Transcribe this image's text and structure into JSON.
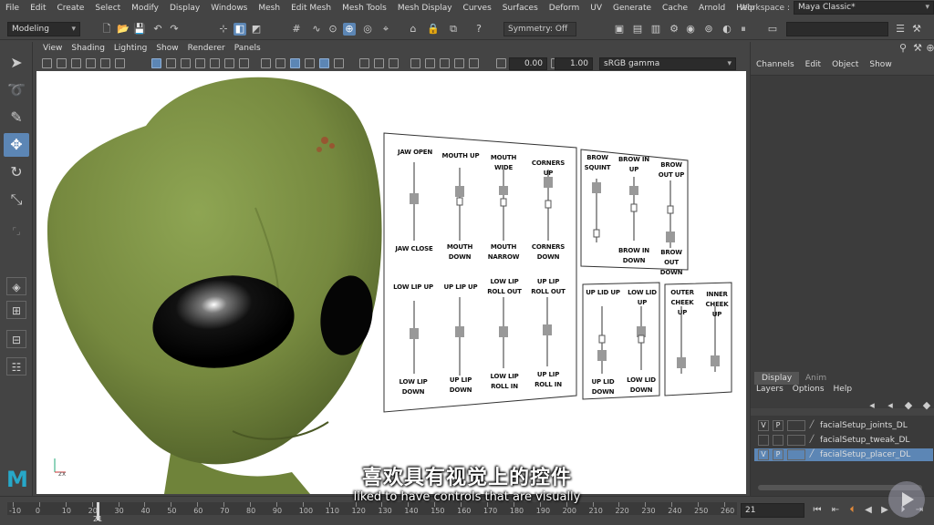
{
  "menubar": {
    "items": [
      "File",
      "Edit",
      "Create",
      "Select",
      "Modify",
      "Display",
      "Windows",
      "Mesh",
      "Edit Mesh",
      "Mesh Tools",
      "Mesh Display",
      "Curves",
      "Surfaces",
      "Deform",
      "UV",
      "Generate",
      "Cache",
      "Arnold",
      "Help"
    ],
    "workspace_label": "Workspace :",
    "workspace_value": "Maya Classic*"
  },
  "statusline": {
    "mode": "Modeling",
    "symmetry": "Symmetry: Off"
  },
  "panel": {
    "menu": [
      "View",
      "Shading",
      "Lighting",
      "Show",
      "Renderer",
      "Panels"
    ],
    "exposure": "0.00",
    "gamma": "1.00",
    "color_space": "sRGB gamma"
  },
  "controls": {
    "panel1": {
      "row1": [
        {
          "top": "JAW OPEN",
          "bottom": "JAW CLOSE"
        },
        {
          "top": "MOUTH UP",
          "bottom": "MOUTH DOWN"
        },
        {
          "top": "MOUTH WIDE",
          "bottom": "MOUTH NARROW"
        },
        {
          "top": "CORNERS UP",
          "bottom": "CORNERS DOWN"
        }
      ],
      "row2": [
        {
          "top": "LOW LIP UP",
          "bottom": "LOW LIP DOWN"
        },
        {
          "top": "UP LIP UP",
          "bottom": "UP LIP DOWN"
        },
        {
          "top": "LOW LIP ROLL OUT",
          "bottom": "LOW LIP ROLL IN"
        },
        {
          "top": "UP LIP ROLL OUT",
          "bottom": "UP LIP ROLL IN"
        }
      ]
    },
    "panel2": [
      {
        "top": "BROW SQUINT",
        "bottom": ""
      },
      {
        "top": "BROW IN UP",
        "bottom": "BROW IN DOWN"
      },
      {
        "top": "BROW OUT UP",
        "bottom": "BROW OUT DOWN"
      }
    ],
    "panel3": [
      {
        "top": "UP LID UP",
        "bottom": "UP LID DOWN"
      },
      {
        "top": "LOW LID UP",
        "bottom": "LOW LID DOWN"
      }
    ],
    "panel4": [
      {
        "top": "OUTER CHEEK UP",
        "bottom": ""
      },
      {
        "top": "INNER CHEEK UP",
        "bottom": ""
      }
    ]
  },
  "channelbox": {
    "menu": [
      "Channels",
      "Edit",
      "Object",
      "Show"
    ],
    "layer_tabs": [
      "Display",
      "Anim"
    ],
    "layer_menu": [
      "Layers",
      "Options",
      "Help"
    ],
    "layers": [
      {
        "v": "V",
        "p": "P",
        "name": "facialSetup_joints_DL",
        "selected": false
      },
      {
        "v": "",
        "p": "",
        "name": "facialSetup_tweak_DL",
        "selected": false
      },
      {
        "v": "V",
        "p": "P",
        "name": "facialSetup_placer_DL",
        "selected": true
      }
    ]
  },
  "timeline": {
    "ticks": [
      "-10",
      "0",
      "10",
      "20",
      "30",
      "40",
      "50",
      "60",
      "70",
      "80",
      "90",
      "100",
      "110",
      "120",
      "130",
      "140",
      "150",
      "160",
      "170",
      "180",
      "190",
      "200",
      "210",
      "220",
      "230",
      "240",
      "250",
      "260"
    ],
    "current_frame": "21",
    "frame_field": "21"
  },
  "subtitles": {
    "chinese": "喜欢具有视觉上的控件",
    "english": "liked to have controls that are visually"
  },
  "colors": {
    "ui_bg": "#444444",
    "accent": "#5c86b5",
    "alien_skin": "#7b9145",
    "viewport_bg": "#ffffff"
  }
}
